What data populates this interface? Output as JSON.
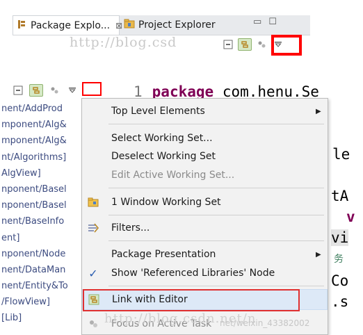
{
  "tabs": {
    "package_explorer_label": "Package Explo...",
    "package_explorer_close": "⊠",
    "project_explorer_label": "Project Explorer",
    "minimize_glyph": "▭",
    "maximize_glyph": "☐"
  },
  "watermark_top": "http://blog.csd",
  "watermark_bottom": "http://blog.csdn.net/n",
  "watermark_small": "net/weixin_43382002",
  "packages": [
    "nent/AddProd",
    "mponent/Alg&",
    "mponent/Alg&",
    "nt/Algorithms]",
    "AlgView]",
    "nponent/Basel",
    "nponent/Basel",
    "nent/BaseInfo",
    "ent]",
    "nponent/Node",
    "nent/DataMan",
    "nent/Entity&To",
    "/FlowView]",
    "[Lib]"
  ],
  "editor": {
    "line_number": "1",
    "keyword": "package",
    "package_name": "com.henu.Se",
    "fragments": [
      "le",
      "tA",
      "v",
      "vi",
      "务",
      "Co",
      ".s"
    ]
  },
  "menu": {
    "items": [
      {
        "label": "Top Level Elements",
        "submenu": true,
        "enabled": true
      },
      {
        "label": "Select Working Set...",
        "submenu": false,
        "enabled": true
      },
      {
        "label": "Deselect Working Set",
        "submenu": false,
        "enabled": true
      },
      {
        "label": "Edit Active Working Set...",
        "submenu": false,
        "enabled": false
      },
      {
        "label": "1 Window Working Set",
        "submenu": false,
        "enabled": true
      },
      {
        "label": "Filters...",
        "submenu": false,
        "enabled": true
      },
      {
        "label": "Package Presentation",
        "submenu": true,
        "enabled": true
      },
      {
        "label": "Show 'Referenced Libraries' Node",
        "submenu": false,
        "enabled": true,
        "checked": true
      },
      {
        "label": "Link with Editor",
        "submenu": false,
        "enabled": true,
        "highlighted": true
      },
      {
        "label": "Focus on Active Task",
        "submenu": false,
        "enabled": false
      }
    ],
    "check_glyph": "✓",
    "submenu_glyph": "▶"
  },
  "colors": {
    "highlight": "#ff0000",
    "keyword": "#7f0055",
    "link_selected_bg": "#dde9f7"
  }
}
